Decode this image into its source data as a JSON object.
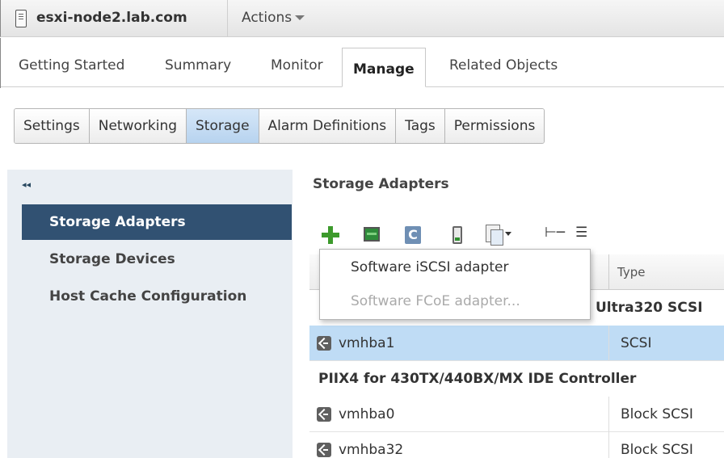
{
  "header": {
    "host_name": "esxi-node2.lab.com",
    "actions_label": "Actions"
  },
  "main_tabs": [
    {
      "label": "Getting Started"
    },
    {
      "label": "Summary"
    },
    {
      "label": "Monitor"
    },
    {
      "label": "Manage",
      "active": true
    },
    {
      "label": "Related Objects"
    }
  ],
  "sub_tabs": [
    {
      "label": "Settings"
    },
    {
      "label": "Networking"
    },
    {
      "label": "Storage",
      "active": true
    },
    {
      "label": "Alarm Definitions"
    },
    {
      "label": "Tags"
    },
    {
      "label": "Permissions"
    }
  ],
  "sidebar": {
    "collapse_glyph": "◂◂",
    "items": [
      {
        "label": "Storage Adapters",
        "active": true
      },
      {
        "label": "Storage Devices"
      },
      {
        "label": "Host Cache Configuration"
      }
    ]
  },
  "content": {
    "title": "Storage Adapters",
    "toolbar": {
      "icons": [
        "add-icon",
        "rescan-icon",
        "refresh-icon",
        "device-icon",
        "copy-icon",
        "column-icon",
        "list-icon"
      ],
      "column_glyph": "⊢─",
      "list_glyph": "☰",
      "refresh_glyph": "C"
    },
    "table": {
      "type_header": "Type",
      "group1_visible_label": "Ultra320 SCSI",
      "group2_label": "PIIX4 for 430TX/440BX/MX IDE Controller",
      "rows": [
        {
          "name": "vmhba1",
          "type": "SCSI",
          "selected": true
        },
        {
          "name": "vmhba0",
          "type": "Block SCSI"
        },
        {
          "name": "vmhba32",
          "type": "Block SCSI"
        }
      ]
    },
    "add_menu": {
      "items": [
        {
          "label": "Software iSCSI adapter",
          "enabled": true
        },
        {
          "label": "Software FCoE adapter...",
          "enabled": false
        }
      ]
    }
  },
  "colors": {
    "sidebar_active_bg": "#315172",
    "tab_active_bg": "#b7d3ef",
    "row_selected_bg": "#bfdcf5",
    "add_icon": "#3d9a2c"
  }
}
